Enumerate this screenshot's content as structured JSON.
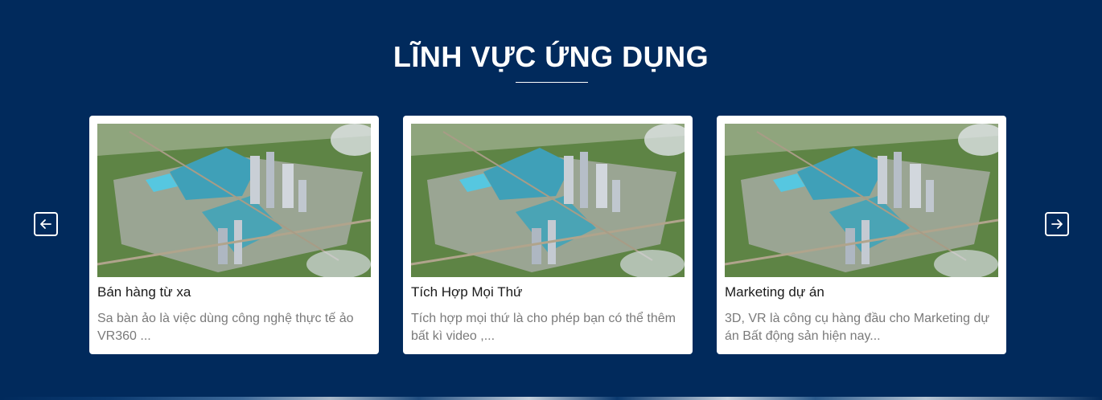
{
  "section": {
    "title": "LĨNH VỰC ỨNG DỤNG"
  },
  "carousel": {
    "prev_icon": "arrow-left-icon",
    "next_icon": "arrow-right-icon",
    "cards": [
      {
        "title": "Bán hàng từ xa",
        "description": "Sa bàn ảo là việc dùng công nghệ thực tế ảo VR360 ..."
      },
      {
        "title": "Tích Hợp Mọi Thứ",
        "description": "Tích hợp mọi thứ là cho phép bạn có thể thêm bất kì video ,..."
      },
      {
        "title": "Marketing dự án",
        "description": "3D, VR là công cụ hàng đầu cho Marketing dự án Bất động sản hiện nay..."
      }
    ]
  },
  "colors": {
    "background": "#012a5c",
    "card": "#ffffff",
    "title": "#ffffff",
    "card_title": "#1a1a1a",
    "card_desc": "#7a7a7a"
  }
}
